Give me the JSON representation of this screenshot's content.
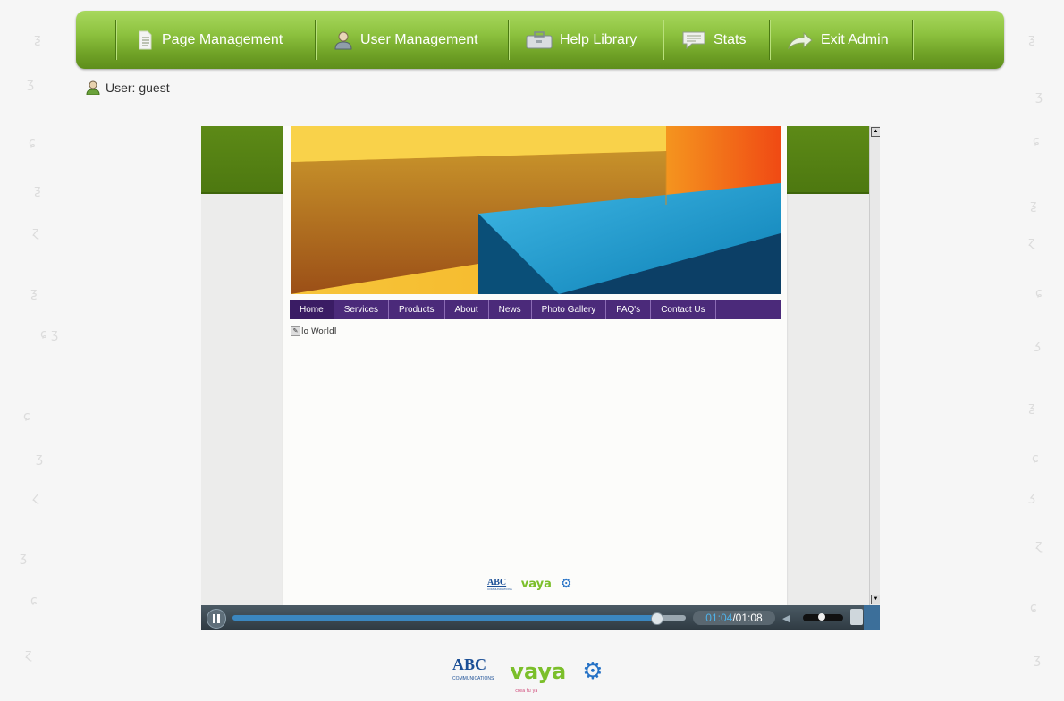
{
  "nav": {
    "items": [
      {
        "label": "Page Management",
        "icon": "page-icon"
      },
      {
        "label": "User Management",
        "icon": "user-icon"
      },
      {
        "label": "Help Library",
        "icon": "briefcase-icon"
      },
      {
        "label": "Stats",
        "icon": "chat-icon"
      },
      {
        "label": "Exit Admin",
        "icon": "arrow-icon"
      }
    ]
  },
  "user": {
    "label": "User: guest"
  },
  "video": {
    "site_nav": [
      "Home",
      "Services",
      "Products",
      "About",
      "News",
      "Photo Gallery",
      "FAQ's",
      "Contact Us"
    ],
    "content_text": "lo World",
    "logos": {
      "abc": "ABC",
      "abc_sub": "COMMUNICATIONS",
      "vaya": "vaya",
      "vaya_sub": "crea tu ya"
    },
    "player": {
      "current_time": "01:04",
      "total_time": "01:08",
      "progress": 0.94
    }
  },
  "footer": {
    "abc": "ABC",
    "abc_sub": "COMMUNICATIONS",
    "vaya": "vaya",
    "vaya_sub": "crea tu ya"
  },
  "colors": {
    "nav_green": "#7fb332",
    "site_nav_purple": "#4b2a7a",
    "player_blue": "#3b87c0"
  }
}
